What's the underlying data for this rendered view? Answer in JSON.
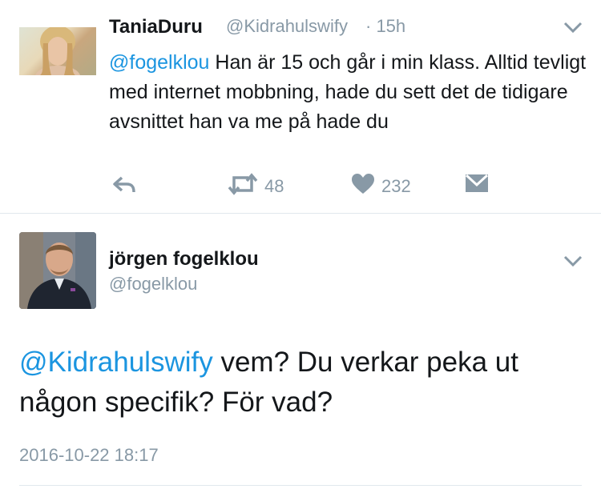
{
  "tweet1": {
    "author_name": "TaniaDuru",
    "author_handle": "@Kidrahulswify",
    "time": "· 15h",
    "mention": "@fogelklou",
    "text": " Han är 15 och går i min klass. Alltid tevligt med internet mobbning, hade du sett det de tidigare avsnittet han va me på hade du",
    "actions": {
      "retweets": "48",
      "likes": "232"
    }
  },
  "tweet2": {
    "author_name": "jörgen fogelklou",
    "author_handle": "@fogelklou",
    "mention": "@Kidrahulswify",
    "text": " vem? Du verkar peka ut någon specifik? För vad?",
    "timestamp": "2016-10-22 18:17"
  },
  "colors": {
    "link": "#1b95e0",
    "secondary": "#8899a6",
    "divider": "#e1e8ed"
  },
  "icons": [
    "reply-icon",
    "retweet-icon",
    "heart-icon",
    "direct-message-icon",
    "chevron-down-icon"
  ]
}
